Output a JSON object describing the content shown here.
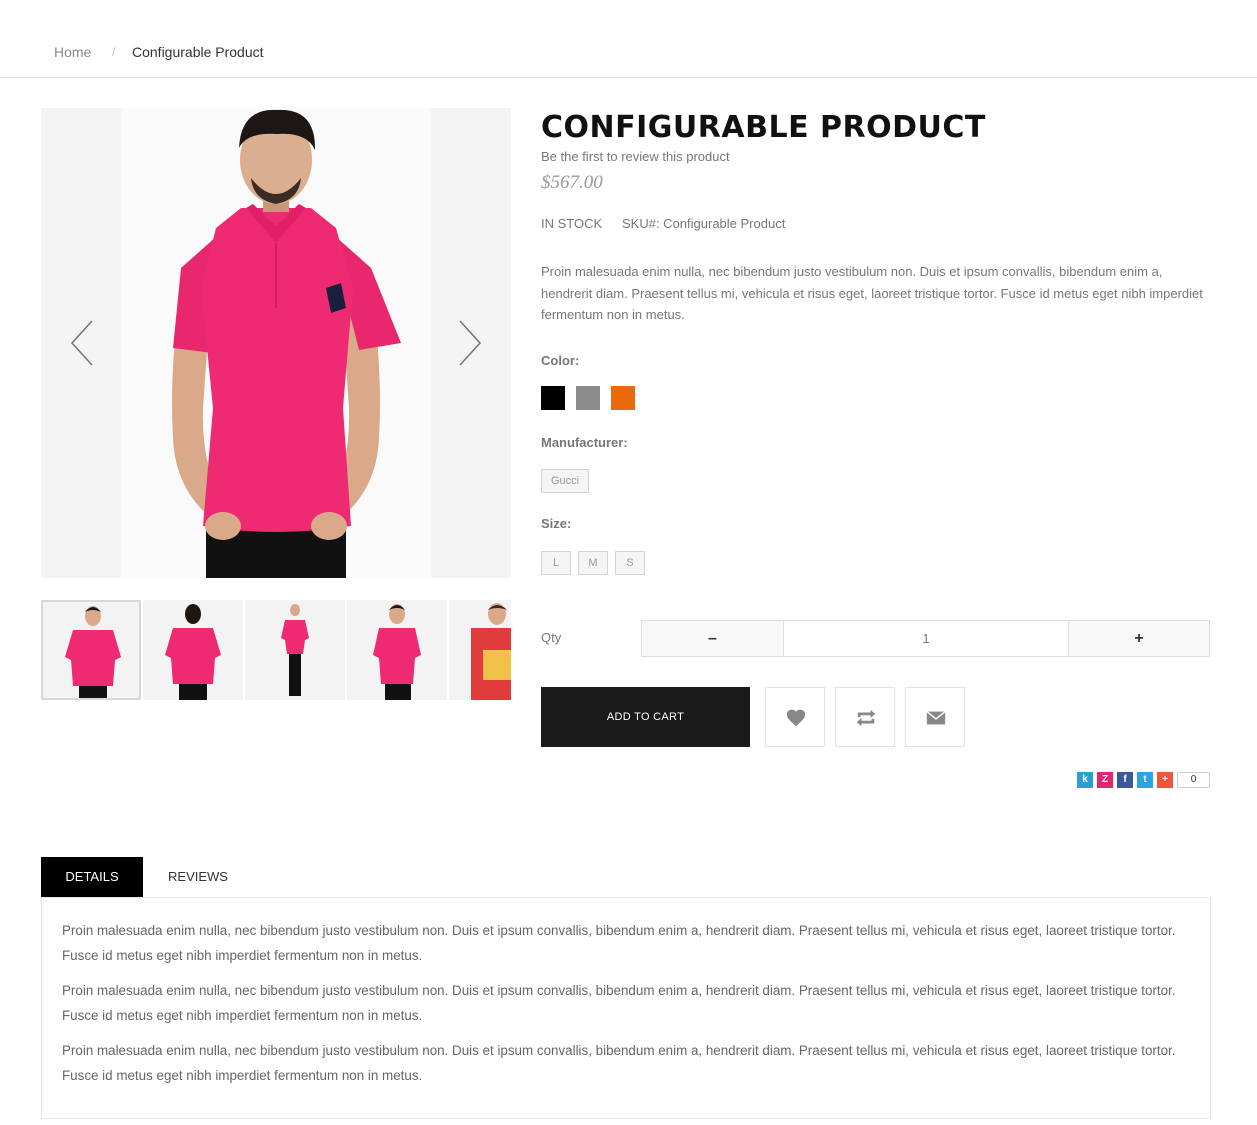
{
  "breadcrumb": {
    "home": "Home",
    "separator": "/",
    "current": "Configurable Product"
  },
  "gallery": {
    "prev_icon": "chevron-left-icon",
    "next_icon": "chevron-right-icon",
    "shirt_color": "#ee2a73",
    "thumbnails": [
      "front",
      "back",
      "full-body",
      "side",
      "red-graphic-tee"
    ]
  },
  "product": {
    "title": "CONFIGURABLE PRODUCT",
    "review_link": "Be the first to review this product",
    "price": "$567.00",
    "stock": "IN STOCK",
    "sku": "SKU#: Configurable Product",
    "description": "Proin malesuada enim nulla, nec bibendum justo vestibulum non. Duis et ipsum convallis, bibendum enim a, hendrerit diam. Praesent tellus mi, vehicula et risus eget, laoreet tristique tortor. Fusce id metus eget nibh imperdiet fermentum non in metus."
  },
  "options": {
    "color_label": "Color:",
    "colors": [
      "#000000",
      "#8c8c8c",
      "#ea6a0c"
    ],
    "manufacturer_label": "Manufacturer:",
    "manufacturer": "Gucci",
    "size_label": "Size:",
    "sizes": [
      "L",
      "M",
      "S"
    ]
  },
  "qty": {
    "label": "Qty",
    "value": "1",
    "minus": "–",
    "plus": "+"
  },
  "actions": {
    "add_to_cart": "ADD TO CART",
    "wishlist_icon": "heart-icon",
    "compare_icon": "compare-arrows-icon",
    "email_icon": "envelope-icon"
  },
  "share": {
    "icons": [
      {
        "name": "kiwi-share-icon",
        "glyph": "k",
        "color": "#2a9fd6"
      },
      {
        "name": "zing-share-icon",
        "glyph": "Z",
        "color": "#e5236e"
      },
      {
        "name": "facebook-icon",
        "glyph": "f",
        "color": "#3b5998"
      },
      {
        "name": "twitter-icon",
        "glyph": "t",
        "color": "#2aa4e4"
      },
      {
        "name": "plus-share-icon",
        "glyph": "+",
        "color": "#f2543a"
      }
    ],
    "count": "0"
  },
  "tabs": {
    "details": "DETAILS",
    "reviews": "REVIEWS"
  },
  "details_text": [
    "Proin malesuada enim nulla, nec bibendum justo vestibulum non. Duis et ipsum convallis, bibendum enim a, hendrerit diam. Praesent tellus mi, vehicula et risus eget, laoreet tristique tortor. Fusce id metus eget nibh imperdiet fermentum non in metus.",
    "Proin malesuada enim nulla, nec bibendum justo vestibulum non. Duis et ipsum convallis, bibendum enim a, hendrerit diam. Praesent tellus mi, vehicula et risus eget, laoreet tristique tortor. Fusce id metus eget nibh imperdiet fermentum non in metus.",
    "Proin malesuada enim nulla, nec bibendum justo vestibulum non. Duis et ipsum convallis, bibendum enim a, hendrerit diam. Praesent tellus mi, vehicula et risus eget, laoreet tristique tortor. Fusce id metus eget nibh imperdiet fermentum non in metus."
  ]
}
